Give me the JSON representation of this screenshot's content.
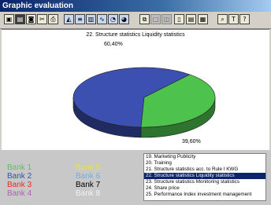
{
  "window": {
    "title": "Graphic evaluation"
  },
  "toolbar": {
    "buttons": [
      {
        "name": "save-icon",
        "glyph": "▣"
      },
      {
        "name": "print-icon",
        "glyph": "▤"
      },
      {
        "name": "camera-icon",
        "glyph": "◙"
      },
      {
        "name": "scissors-icon",
        "glyph": "✂"
      },
      {
        "name": "printer-icon",
        "glyph": "⎙"
      },
      {
        "name": "area-chart-icon",
        "glyph": "◭"
      },
      {
        "name": "bar-chart-horizontal-icon",
        "glyph": "≡"
      },
      {
        "name": "bar-chart-icon",
        "glyph": "▥"
      },
      {
        "name": "line-chart-icon",
        "glyph": "∿"
      },
      {
        "name": "pie-chart-3d-icon",
        "glyph": "◔"
      },
      {
        "name": "pie-chart-icon",
        "glyph": "◕"
      },
      {
        "name": "dual-chart-icon",
        "glyph": "⧉"
      },
      {
        "name": "single-view-icon",
        "glyph": "□"
      },
      {
        "name": "split-view-icon",
        "glyph": "◫"
      },
      {
        "name": "page-icon",
        "glyph": "▯"
      },
      {
        "name": "page-list-icon",
        "glyph": "▤"
      },
      {
        "name": "grid-view-icon",
        "glyph": "▦"
      },
      {
        "name": "zoom-icon",
        "glyph": "⌕"
      },
      {
        "name": "format-icon",
        "glyph": "T"
      },
      {
        "name": "help-icon",
        "glyph": "?"
      }
    ]
  },
  "chart_data": {
    "type": "pie",
    "title": "22. Structure statistics Liquidity statistics",
    "slices": [
      {
        "label": "60,40%",
        "value": 60.4,
        "color": "#3b50b0"
      },
      {
        "label": "39,60%",
        "value": 39.6,
        "color": "#4dc24d"
      }
    ]
  },
  "legend": [
    {
      "label": "Bank 1",
      "color": "#5ec15e"
    },
    {
      "label": "Bank 2",
      "color": "#3050b0"
    },
    {
      "label": "Bank 3",
      "color": "#e03020"
    },
    {
      "label": "Bank 4",
      "color": "#b060b0"
    },
    {
      "label": "Bank 5",
      "color": "#e8e050"
    },
    {
      "label": "Bank 6",
      "color": "#70b0e0"
    },
    {
      "label": "Bank 7",
      "color": "#000000"
    },
    {
      "label": "Bank 8",
      "color": "#f2f2f2"
    }
  ],
  "stats_list": {
    "items": [
      "19. Marketing Publicity",
      "20. Training",
      "21. Structure statistics acc. to Rule I KWG",
      "22. Structure statistics Liquidity statistics",
      "23. Structure statistics Monitoring statistics",
      "24. Share price",
      "25. Performance Index investment management"
    ],
    "selected_index": 3
  }
}
